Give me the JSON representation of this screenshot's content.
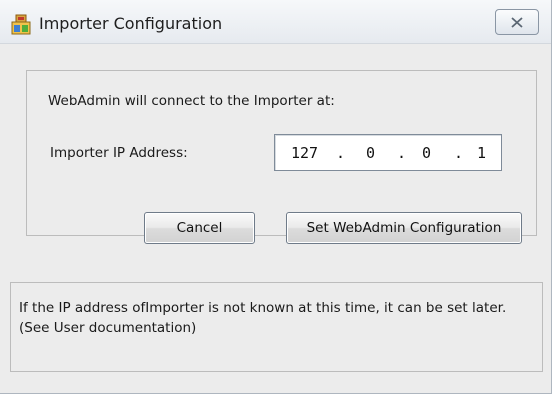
{
  "window": {
    "title": "Importer Configuration",
    "close_label": "close",
    "icon": "importer-app-icon"
  },
  "main": {
    "prompt": "WebAdmin will connect to the Importer at:",
    "ip_label": "Importer IP Address:",
    "ip": {
      "octet1": "127",
      "octet2": "0",
      "octet3": "0",
      "octet4": "1",
      "separator": "."
    },
    "buttons": {
      "cancel": "Cancel",
      "set": "Set WebAdmin Configuration"
    }
  },
  "info": {
    "text": "If the IP address ofImporter is not known at this time, it can be set later. (See User documentation)"
  },
  "colors": {
    "accent": "#3a6ea5",
    "window_bg": "#ececec"
  }
}
